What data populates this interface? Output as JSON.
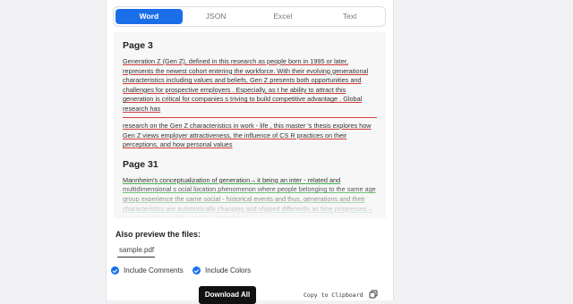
{
  "tabs": [
    "Word",
    "JSON",
    "Excel",
    "Text"
  ],
  "preview": {
    "page3_title": "Page 3",
    "page3_para1": "Generation Z (Gen Z), defined in this research as people born in 1995 or later, represents the newest cohort entering the workforce. With their evolving generational characteristics including values and beliefs, Gen Z presents both opportunities and challenges for prospective employers . Especially, as t he ability to attract this generation is critical for companies s triving to build competitive advantage . Global research has",
    "page3_para2": "research on the Gen Z characteristics in work - life , this master 's thesis explores how Gen Z views employer attractiveness, the influence of CS R practices on their perceptions, and how personal values",
    "page31_title": "Page 31",
    "page31_para1": "Mannheim's conceptualization of generation – it being an inter - related and multidimensional s ocial location phenomenon where people belonging to the same age group experience the same social - historical events and thus, generations and their characteristics are automatically changing and shaped differently as time progresses – has since been widely used in generational"
  },
  "files": {
    "heading": "Also preview the files:",
    "name": "sample.pdf"
  },
  "options": {
    "include_comments": "Include Comments",
    "include_colors": "Include Colors"
  },
  "actions": {
    "download": "Download All",
    "copy": "Copy to Clipboard"
  },
  "colors": {
    "accent": "#1a6fe8",
    "underline_red": "#d23b3b",
    "underline_green": "#36b048"
  },
  "icons": [
    "check-icon",
    "copy-icon"
  ]
}
